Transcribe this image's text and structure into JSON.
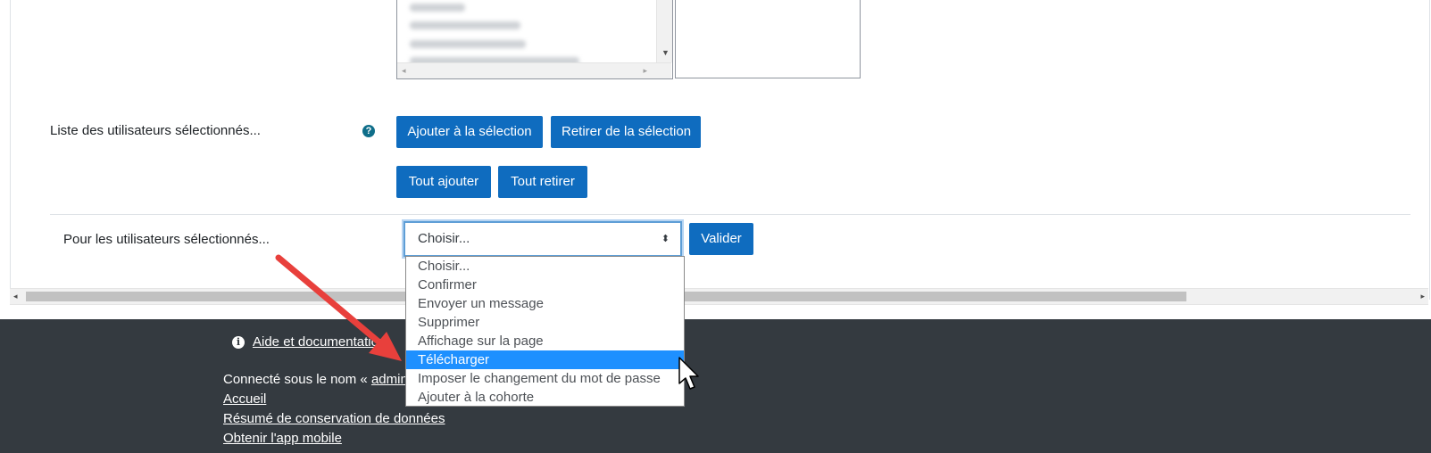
{
  "list_boxes": {
    "left_scroll_down_arrow": "▼",
    "left_scroll_left_arrow": "◂",
    "left_scroll_right_arrow": "▸"
  },
  "selected_users": {
    "label": "Liste des utilisateurs sélectionnés...",
    "help_icon": "?",
    "add_to_selection": "Ajouter à la sélection",
    "remove_from_selection": "Retirer de la sélection",
    "add_all": "Tout ajouter",
    "remove_all": "Tout retirer"
  },
  "bulk_action": {
    "label": "Pour les utilisateurs sélectionnés...",
    "select_value": "Choisir...",
    "caret": "⬍",
    "submit": "Valider",
    "options": [
      "Choisir...",
      "Confirmer",
      "Envoyer un message",
      "Supprimer",
      "Affichage sur la page",
      "Télécharger",
      "Imposer le changement du mot de passe",
      "Ajouter à la cohorte"
    ],
    "highlighted_index": 5
  },
  "page_scrollbar": {
    "left_arrow": "◂",
    "right_arrow": "▸"
  },
  "footer": {
    "info_icon": "i",
    "help_link": "Aide et documentation",
    "logged_in_prefix": "Connecté sous le nom « ",
    "username": "admin",
    "home_link": "Accueil",
    "data_retention_link": "Résumé de conservation de données",
    "mobile_app_link": "Obtenir l'app mobile"
  },
  "colors": {
    "primary": "#0f6cbf",
    "footer_bg": "#343a40",
    "highlight": "#1e90ff",
    "annotation_arrow": "#e8403c"
  }
}
